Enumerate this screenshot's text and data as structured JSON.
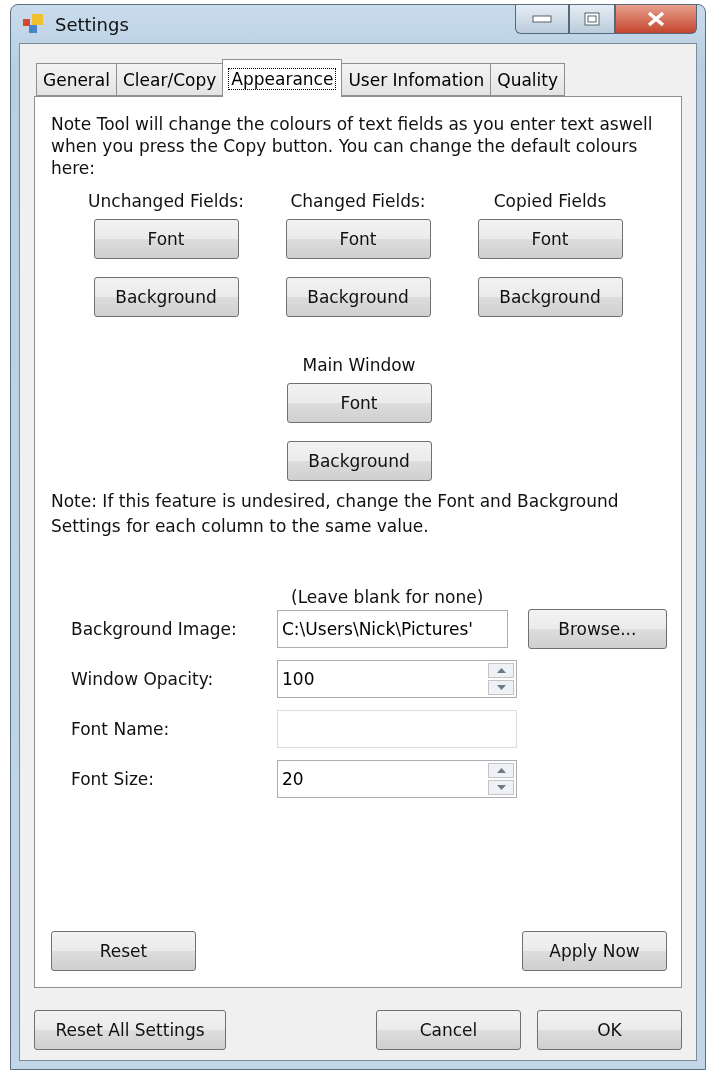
{
  "window": {
    "title": "Settings"
  },
  "tabs": [
    {
      "label": "General",
      "selected": false
    },
    {
      "label": "Clear/Copy",
      "selected": false
    },
    {
      "label": "Appearance",
      "selected": true
    },
    {
      "label": "User Infomation",
      "selected": false
    },
    {
      "label": "Quality",
      "selected": false
    }
  ],
  "intro": "Note Tool will change the colours of text fields as you enter text aswell when you press the Copy button. You can change the default colours here:",
  "columns": [
    {
      "heading": "Unchanged Fields:",
      "buttons": [
        "Font",
        "Background"
      ]
    },
    {
      "heading": "Changed Fields:",
      "buttons": [
        "Font",
        "Background"
      ]
    },
    {
      "heading": "Copied Fields",
      "buttons": [
        "Font",
        "Background"
      ]
    }
  ],
  "main_window": {
    "heading": "Main Window",
    "buttons": [
      "Font",
      "Background"
    ]
  },
  "note": "Note: If this feature is undesired, change the Font and Background Settings for each column to the same value.",
  "hint": "(Leave blank for none)",
  "fields": [
    {
      "label": "Background Image:",
      "kind": "text",
      "value": "C:\\Users\\Nick\\Pictures'",
      "button": "Browse..."
    },
    {
      "label": "Window Opacity:",
      "kind": "spinner",
      "value": "100"
    },
    {
      "label": "Font Name:",
      "kind": "text"
    },
    {
      "label": "Font Size:",
      "kind": "spinner",
      "value": "20"
    }
  ],
  "panel_buttons": [
    "Reset",
    "Apply Now"
  ],
  "footer_buttons": [
    "Reset All Settings",
    "Cancel",
    "OK"
  ]
}
